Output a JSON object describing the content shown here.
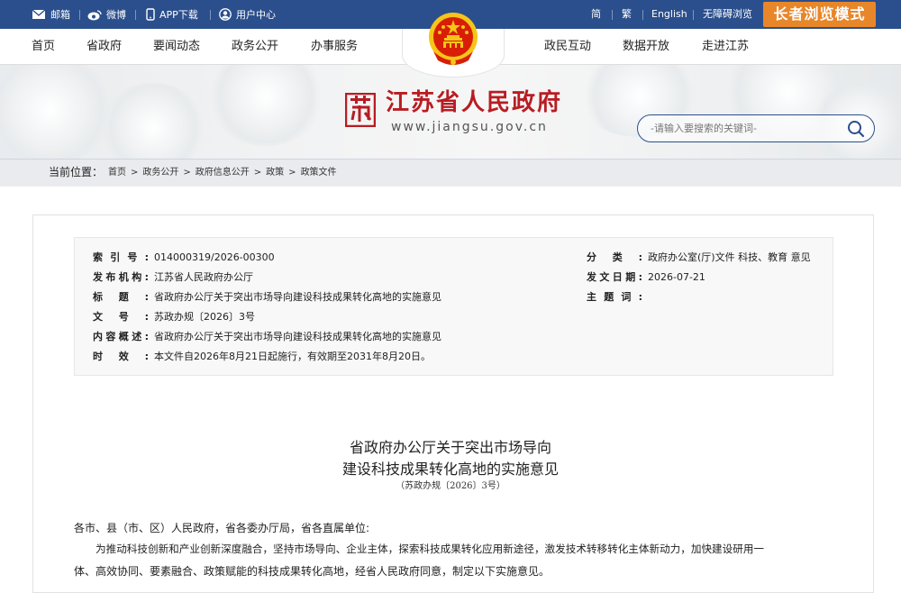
{
  "topbar": {
    "mail": "邮箱",
    "weibo": "微博",
    "app": "APP下载",
    "user": "用户中心",
    "simplified": "简",
    "traditional": "繁",
    "english": "English",
    "accessible": "无障碍浏览",
    "elder_mode": "长者浏览模式"
  },
  "nav": {
    "left": [
      "首页",
      "省政府",
      "要闻动态",
      "政务公开",
      "办事服务"
    ],
    "right": [
      "政民互动",
      "数据开放",
      "走进江苏"
    ]
  },
  "brand": {
    "mark": "苏",
    "title": "江苏省人民政府",
    "url": "www.jiangsu.gov.cn"
  },
  "search": {
    "placeholder": "-请输入要搜索的关键词-"
  },
  "breadcrumb": {
    "label": "当前位置：",
    "items": [
      "首页",
      "政务公开",
      "政府信息公开",
      "政策",
      "政策文件"
    ],
    "sep": ">"
  },
  "meta": {
    "index_key": "索引号:",
    "index_val": "014000319/2026-00300",
    "issuer_key": "发布机构:",
    "issuer_val": "江苏省人民政府办公厅",
    "title_key": "标题:",
    "title_val": "省政府办公厅关于突出市场导向建设科技成果转化高地的实施意见",
    "docno_key": "文号:",
    "docno_val": "苏政办规〔2026〕3号",
    "summary_key": "内容概述:",
    "summary_val": "省政府办公厅关于突出市场导向建设科技成果转化高地的实施意见",
    "validity_key": "时效:",
    "validity_val": "本文件自2026年8月21日起施行，有效期至2031年8月20日。",
    "category_key": "分类:",
    "category_val": "政府办公室(厅)文件 科技、教育 意见",
    "date_key": "发文日期:",
    "date_val": "2026-07-21",
    "subject_key": "主题词:",
    "subject_val": ""
  },
  "doc": {
    "title_line1": "省政府办公厅关于突出市场导向",
    "title_line2": "建设科技成果转化高地的实施意见",
    "number": "（苏政办规〔2026〕3号）",
    "salutation": "各市、县（市、区）人民政府，省各委办厅局，省各直属单位:",
    "para1_line1": "为推动科技创新和产业创新深度融合，坚持市场导向、企业主体，探索科技成果转化应用新途径，激发技术转移转化主体新动力，加快建设研用一",
    "para1_line2": "体、高效协同、要素融合、政策赋能的科技成果转化高地，经省人民政府同意，制定以下实施意见。"
  },
  "colors": {
    "topbar": "#2b4f8c",
    "elder_button": "#e8862a",
    "brand_red": "#b81c22",
    "emblem_red": "#d81e06",
    "emblem_gold": "#f5c518"
  },
  "icons": [
    "mail-icon",
    "weibo-icon",
    "phone-icon",
    "user-icon",
    "search-icon",
    "national-emblem-icon"
  ]
}
